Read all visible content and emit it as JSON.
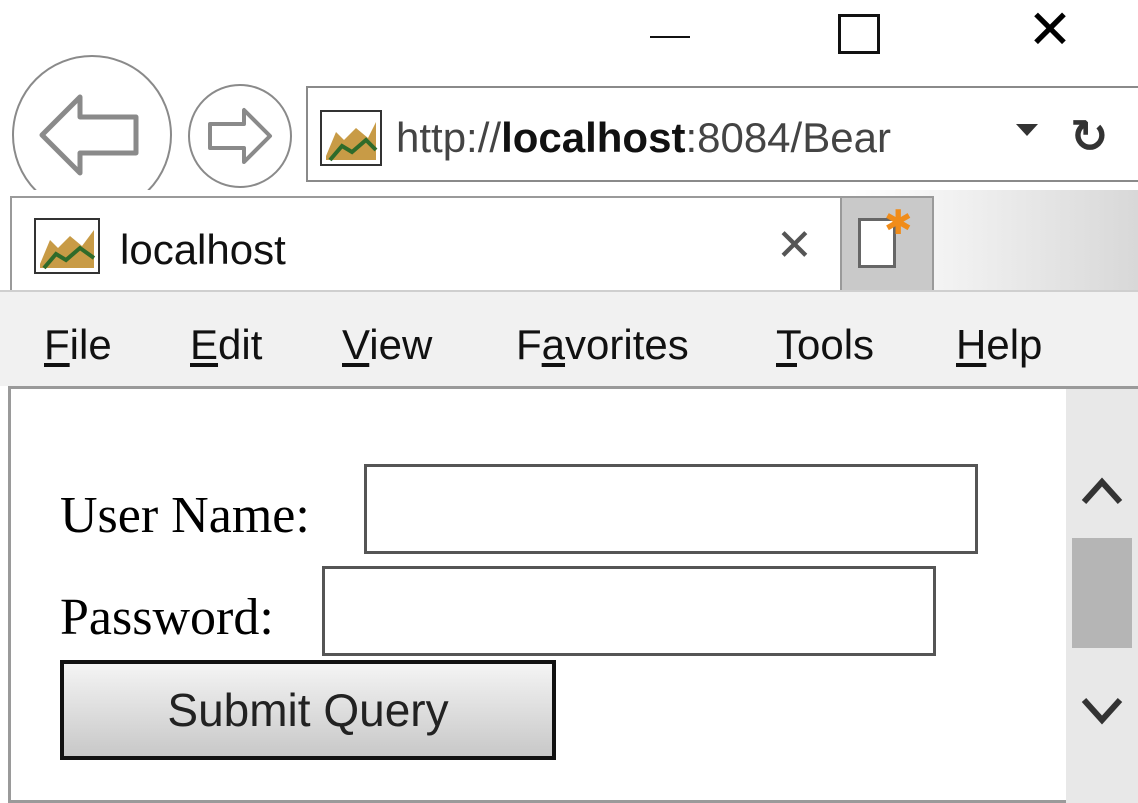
{
  "window": {
    "controls": {
      "minimize_icon": "minimize-icon",
      "maximize_icon": "maximize-icon",
      "close_symbol": "✕"
    }
  },
  "nav": {
    "back_icon": "arrow-left-icon",
    "forward_icon": "arrow-right-icon"
  },
  "address_bar": {
    "url_prefix": "http://",
    "url_host": "localhost",
    "url_rest": ":8084/Bear",
    "favicon": "tomcat-favicon-icon",
    "dropdown_icon": "chevron-down-icon",
    "refresh_symbol": "↻"
  },
  "tabs": [
    {
      "title": "localhost",
      "close_symbol": "✕",
      "favicon": "tomcat-favicon-icon"
    }
  ],
  "new_tab": {
    "icon": "new-tab-icon",
    "accent_color": "#f08c1a"
  },
  "menu": [
    {
      "key": "F",
      "rest": "ile"
    },
    {
      "key": "E",
      "rest": "dit"
    },
    {
      "key": "V",
      "rest": "iew"
    },
    {
      "pre": "F",
      "key": "a",
      "rest": "vorites"
    },
    {
      "key": "T",
      "rest": "ools"
    },
    {
      "key": "H",
      "rest": "elp"
    }
  ],
  "form": {
    "username_label": "User Name:",
    "username_value": "",
    "password_label": "Password:",
    "password_value": "",
    "submit_label": "Submit Query"
  },
  "scrollbar": {
    "up_icon": "chevron-up-icon",
    "down_icon": "chevron-down-icon"
  }
}
